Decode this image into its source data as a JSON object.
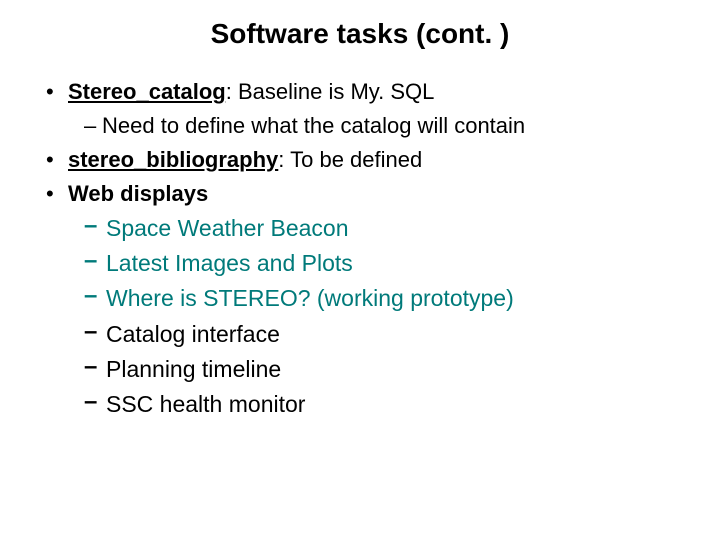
{
  "title": "Software tasks (cont. )",
  "items": {
    "i1_bold": "Stereo_catalog",
    "i1_rest": ": Baseline is My. SQL",
    "i1_sub": "Need to define what the catalog will contain",
    "i2_bold": "stereo_bibliography",
    "i2_rest": ": To be defined",
    "i3_bold": "Web displays",
    "wd1": "Space Weather Beacon",
    "wd2": "Latest Images and Plots",
    "wd3": "Where is STEREO? (working prototype)",
    "wd4": "Catalog interface",
    "wd5": "Planning timeline",
    "wd6": "SSC health monitor"
  }
}
